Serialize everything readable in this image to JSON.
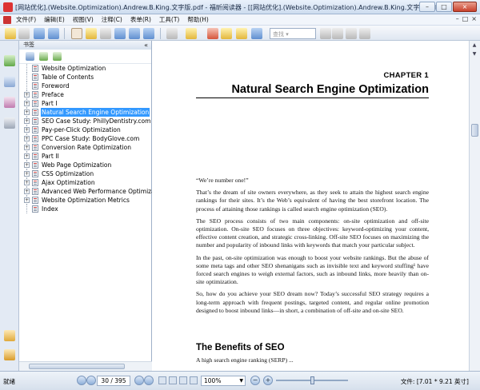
{
  "window": {
    "title": "[网站优化].(Website.Optimization).Andrew.B.King.文字版.pdf - 福昕阅读器 - [[网站优化].(Website.Optimization).Andrew.B.King.文字版.pdf]",
    "controls": [
      "–",
      "□",
      "×"
    ]
  },
  "menu": {
    "items": [
      "文件(F)",
      "编辑(E)",
      "视图(V)",
      "注释(C)",
      "表单(R)",
      "工具(T)",
      "帮助(H)"
    ],
    "mdi_controls": [
      "–",
      "□",
      "×"
    ]
  },
  "toolbar": {
    "search_placeholder": "查找 ▾"
  },
  "bookmarks": {
    "panel_title": "书签",
    "collapse_glyph": "«",
    "items": [
      {
        "label": "Website Optimization",
        "expandable": false,
        "selected": false
      },
      {
        "label": "Table of Contents",
        "expandable": false,
        "selected": false
      },
      {
        "label": "Foreword",
        "expandable": false,
        "selected": false
      },
      {
        "label": "Preface",
        "expandable": true,
        "selected": false
      },
      {
        "label": "Part I",
        "expandable": true,
        "selected": false
      },
      {
        "label": "Natural Search Engine Optimization",
        "expandable": true,
        "selected": true
      },
      {
        "label": "SEO Case Study: PhillyDentistry.com",
        "expandable": true,
        "selected": false
      },
      {
        "label": "Pay-per-Click Optimization",
        "expandable": true,
        "selected": false
      },
      {
        "label": "PPC Case Study: BodyGlove.com",
        "expandable": true,
        "selected": false
      },
      {
        "label": "Conversion Rate Optimization",
        "expandable": true,
        "selected": false
      },
      {
        "label": "Part II",
        "expandable": true,
        "selected": false
      },
      {
        "label": "Web Page Optimization",
        "expandable": true,
        "selected": false
      },
      {
        "label": "CSS Optimization",
        "expandable": true,
        "selected": false
      },
      {
        "label": "Ajax Optimization",
        "expandable": true,
        "selected": false
      },
      {
        "label": "Advanced Web Performance Optimization",
        "expandable": true,
        "selected": false
      },
      {
        "label": "Website Optimization Metrics",
        "expandable": true,
        "selected": false
      },
      {
        "label": "Index",
        "expandable": false,
        "selected": false
      }
    ]
  },
  "document": {
    "chapter_label": "CHAPTER 1",
    "chapter_title": "Natural Search Engine Optimization",
    "paragraphs": [
      "“We’re number one!”",
      "That’s the dream of site owners everywhere, as they seek to attain the highest search engine rankings for their sites. It’s the Web’s equivalent of having the best storefront location. The process of attaining those rankings is called search engine optimization (SEO).",
      "The SEO process consists of two main components: on-site optimization and off-site optimization. On-site SEO focuses on three objectives: keyword-optimizing your content, effective content creation, and strategic cross-linking. Off-site SEO focuses on maximizing the number and popularity of inbound links with keywords that match your particular subject.",
      "In the past, on-site optimization was enough to boost your website rankings. But the abuse of some meta tags and other SEO shenanigans such as invisible text and keyword stuffing¹ have forced search engines to weigh external factors, such as inbound links, more heavily than on-site optimization.",
      "So, how do you achieve your SEO dream now? Today’s successful SEO strategy requires a long-term approach with frequent postings, targeted content, and regular online promotion designed to boost inbound links—in short, a combination of off-site and on-site SEO."
    ],
    "section_heading": "The Benefits of SEO",
    "cutoff_line": "A high search engine ranking (SERP) ..."
  },
  "status": {
    "ready": "就绪",
    "page": "30 / 395",
    "zoom": "100%",
    "zoom_level_fraction": 0.5,
    "page_size": "文件: [7.01 * 9.21 英寸]"
  },
  "colors": {
    "selection": "#3399ff",
    "chrome": "#dfe7f1"
  }
}
